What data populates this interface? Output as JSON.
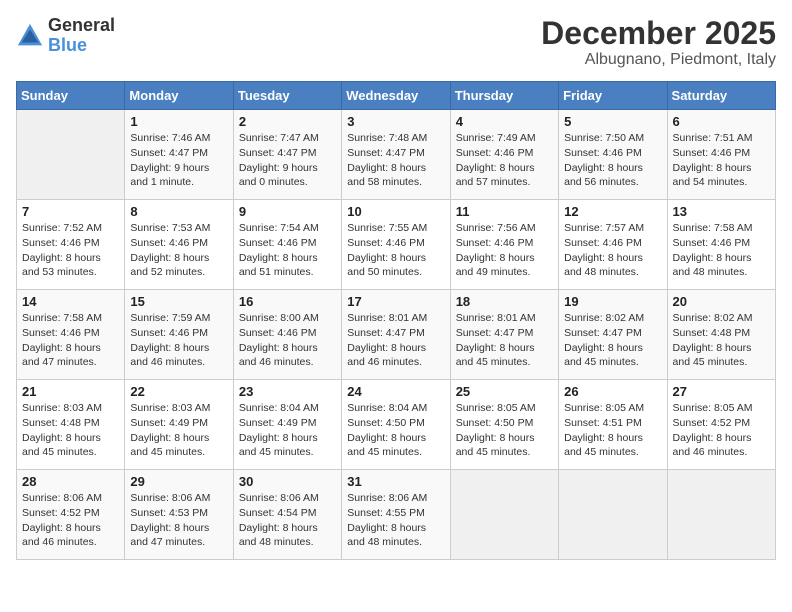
{
  "logo": {
    "general": "General",
    "blue": "Blue"
  },
  "title": {
    "month": "December 2025",
    "location": "Albugnano, Piedmont, Italy"
  },
  "headers": [
    "Sunday",
    "Monday",
    "Tuesday",
    "Wednesday",
    "Thursday",
    "Friday",
    "Saturday"
  ],
  "weeks": [
    [
      {
        "day": "",
        "info": ""
      },
      {
        "day": "1",
        "info": "Sunrise: 7:46 AM\nSunset: 4:47 PM\nDaylight: 9 hours\nand 1 minute."
      },
      {
        "day": "2",
        "info": "Sunrise: 7:47 AM\nSunset: 4:47 PM\nDaylight: 9 hours\nand 0 minutes."
      },
      {
        "day": "3",
        "info": "Sunrise: 7:48 AM\nSunset: 4:47 PM\nDaylight: 8 hours\nand 58 minutes."
      },
      {
        "day": "4",
        "info": "Sunrise: 7:49 AM\nSunset: 4:46 PM\nDaylight: 8 hours\nand 57 minutes."
      },
      {
        "day": "5",
        "info": "Sunrise: 7:50 AM\nSunset: 4:46 PM\nDaylight: 8 hours\nand 56 minutes."
      },
      {
        "day": "6",
        "info": "Sunrise: 7:51 AM\nSunset: 4:46 PM\nDaylight: 8 hours\nand 54 minutes."
      }
    ],
    [
      {
        "day": "7",
        "info": "Sunrise: 7:52 AM\nSunset: 4:46 PM\nDaylight: 8 hours\nand 53 minutes."
      },
      {
        "day": "8",
        "info": "Sunrise: 7:53 AM\nSunset: 4:46 PM\nDaylight: 8 hours\nand 52 minutes."
      },
      {
        "day": "9",
        "info": "Sunrise: 7:54 AM\nSunset: 4:46 PM\nDaylight: 8 hours\nand 51 minutes."
      },
      {
        "day": "10",
        "info": "Sunrise: 7:55 AM\nSunset: 4:46 PM\nDaylight: 8 hours\nand 50 minutes."
      },
      {
        "day": "11",
        "info": "Sunrise: 7:56 AM\nSunset: 4:46 PM\nDaylight: 8 hours\nand 49 minutes."
      },
      {
        "day": "12",
        "info": "Sunrise: 7:57 AM\nSunset: 4:46 PM\nDaylight: 8 hours\nand 48 minutes."
      },
      {
        "day": "13",
        "info": "Sunrise: 7:58 AM\nSunset: 4:46 PM\nDaylight: 8 hours\nand 48 minutes."
      }
    ],
    [
      {
        "day": "14",
        "info": "Sunrise: 7:58 AM\nSunset: 4:46 PM\nDaylight: 8 hours\nand 47 minutes."
      },
      {
        "day": "15",
        "info": "Sunrise: 7:59 AM\nSunset: 4:46 PM\nDaylight: 8 hours\nand 46 minutes."
      },
      {
        "day": "16",
        "info": "Sunrise: 8:00 AM\nSunset: 4:46 PM\nDaylight: 8 hours\nand 46 minutes."
      },
      {
        "day": "17",
        "info": "Sunrise: 8:01 AM\nSunset: 4:47 PM\nDaylight: 8 hours\nand 46 minutes."
      },
      {
        "day": "18",
        "info": "Sunrise: 8:01 AM\nSunset: 4:47 PM\nDaylight: 8 hours\nand 45 minutes."
      },
      {
        "day": "19",
        "info": "Sunrise: 8:02 AM\nSunset: 4:47 PM\nDaylight: 8 hours\nand 45 minutes."
      },
      {
        "day": "20",
        "info": "Sunrise: 8:02 AM\nSunset: 4:48 PM\nDaylight: 8 hours\nand 45 minutes."
      }
    ],
    [
      {
        "day": "21",
        "info": "Sunrise: 8:03 AM\nSunset: 4:48 PM\nDaylight: 8 hours\nand 45 minutes."
      },
      {
        "day": "22",
        "info": "Sunrise: 8:03 AM\nSunset: 4:49 PM\nDaylight: 8 hours\nand 45 minutes."
      },
      {
        "day": "23",
        "info": "Sunrise: 8:04 AM\nSunset: 4:49 PM\nDaylight: 8 hours\nand 45 minutes."
      },
      {
        "day": "24",
        "info": "Sunrise: 8:04 AM\nSunset: 4:50 PM\nDaylight: 8 hours\nand 45 minutes."
      },
      {
        "day": "25",
        "info": "Sunrise: 8:05 AM\nSunset: 4:50 PM\nDaylight: 8 hours\nand 45 minutes."
      },
      {
        "day": "26",
        "info": "Sunrise: 8:05 AM\nSunset: 4:51 PM\nDaylight: 8 hours\nand 45 minutes."
      },
      {
        "day": "27",
        "info": "Sunrise: 8:05 AM\nSunset: 4:52 PM\nDaylight: 8 hours\nand 46 minutes."
      }
    ],
    [
      {
        "day": "28",
        "info": "Sunrise: 8:06 AM\nSunset: 4:52 PM\nDaylight: 8 hours\nand 46 minutes."
      },
      {
        "day": "29",
        "info": "Sunrise: 8:06 AM\nSunset: 4:53 PM\nDaylight: 8 hours\nand 47 minutes."
      },
      {
        "day": "30",
        "info": "Sunrise: 8:06 AM\nSunset: 4:54 PM\nDaylight: 8 hours\nand 48 minutes."
      },
      {
        "day": "31",
        "info": "Sunrise: 8:06 AM\nSunset: 4:55 PM\nDaylight: 8 hours\nand 48 minutes."
      },
      {
        "day": "",
        "info": ""
      },
      {
        "day": "",
        "info": ""
      },
      {
        "day": "",
        "info": ""
      }
    ]
  ]
}
